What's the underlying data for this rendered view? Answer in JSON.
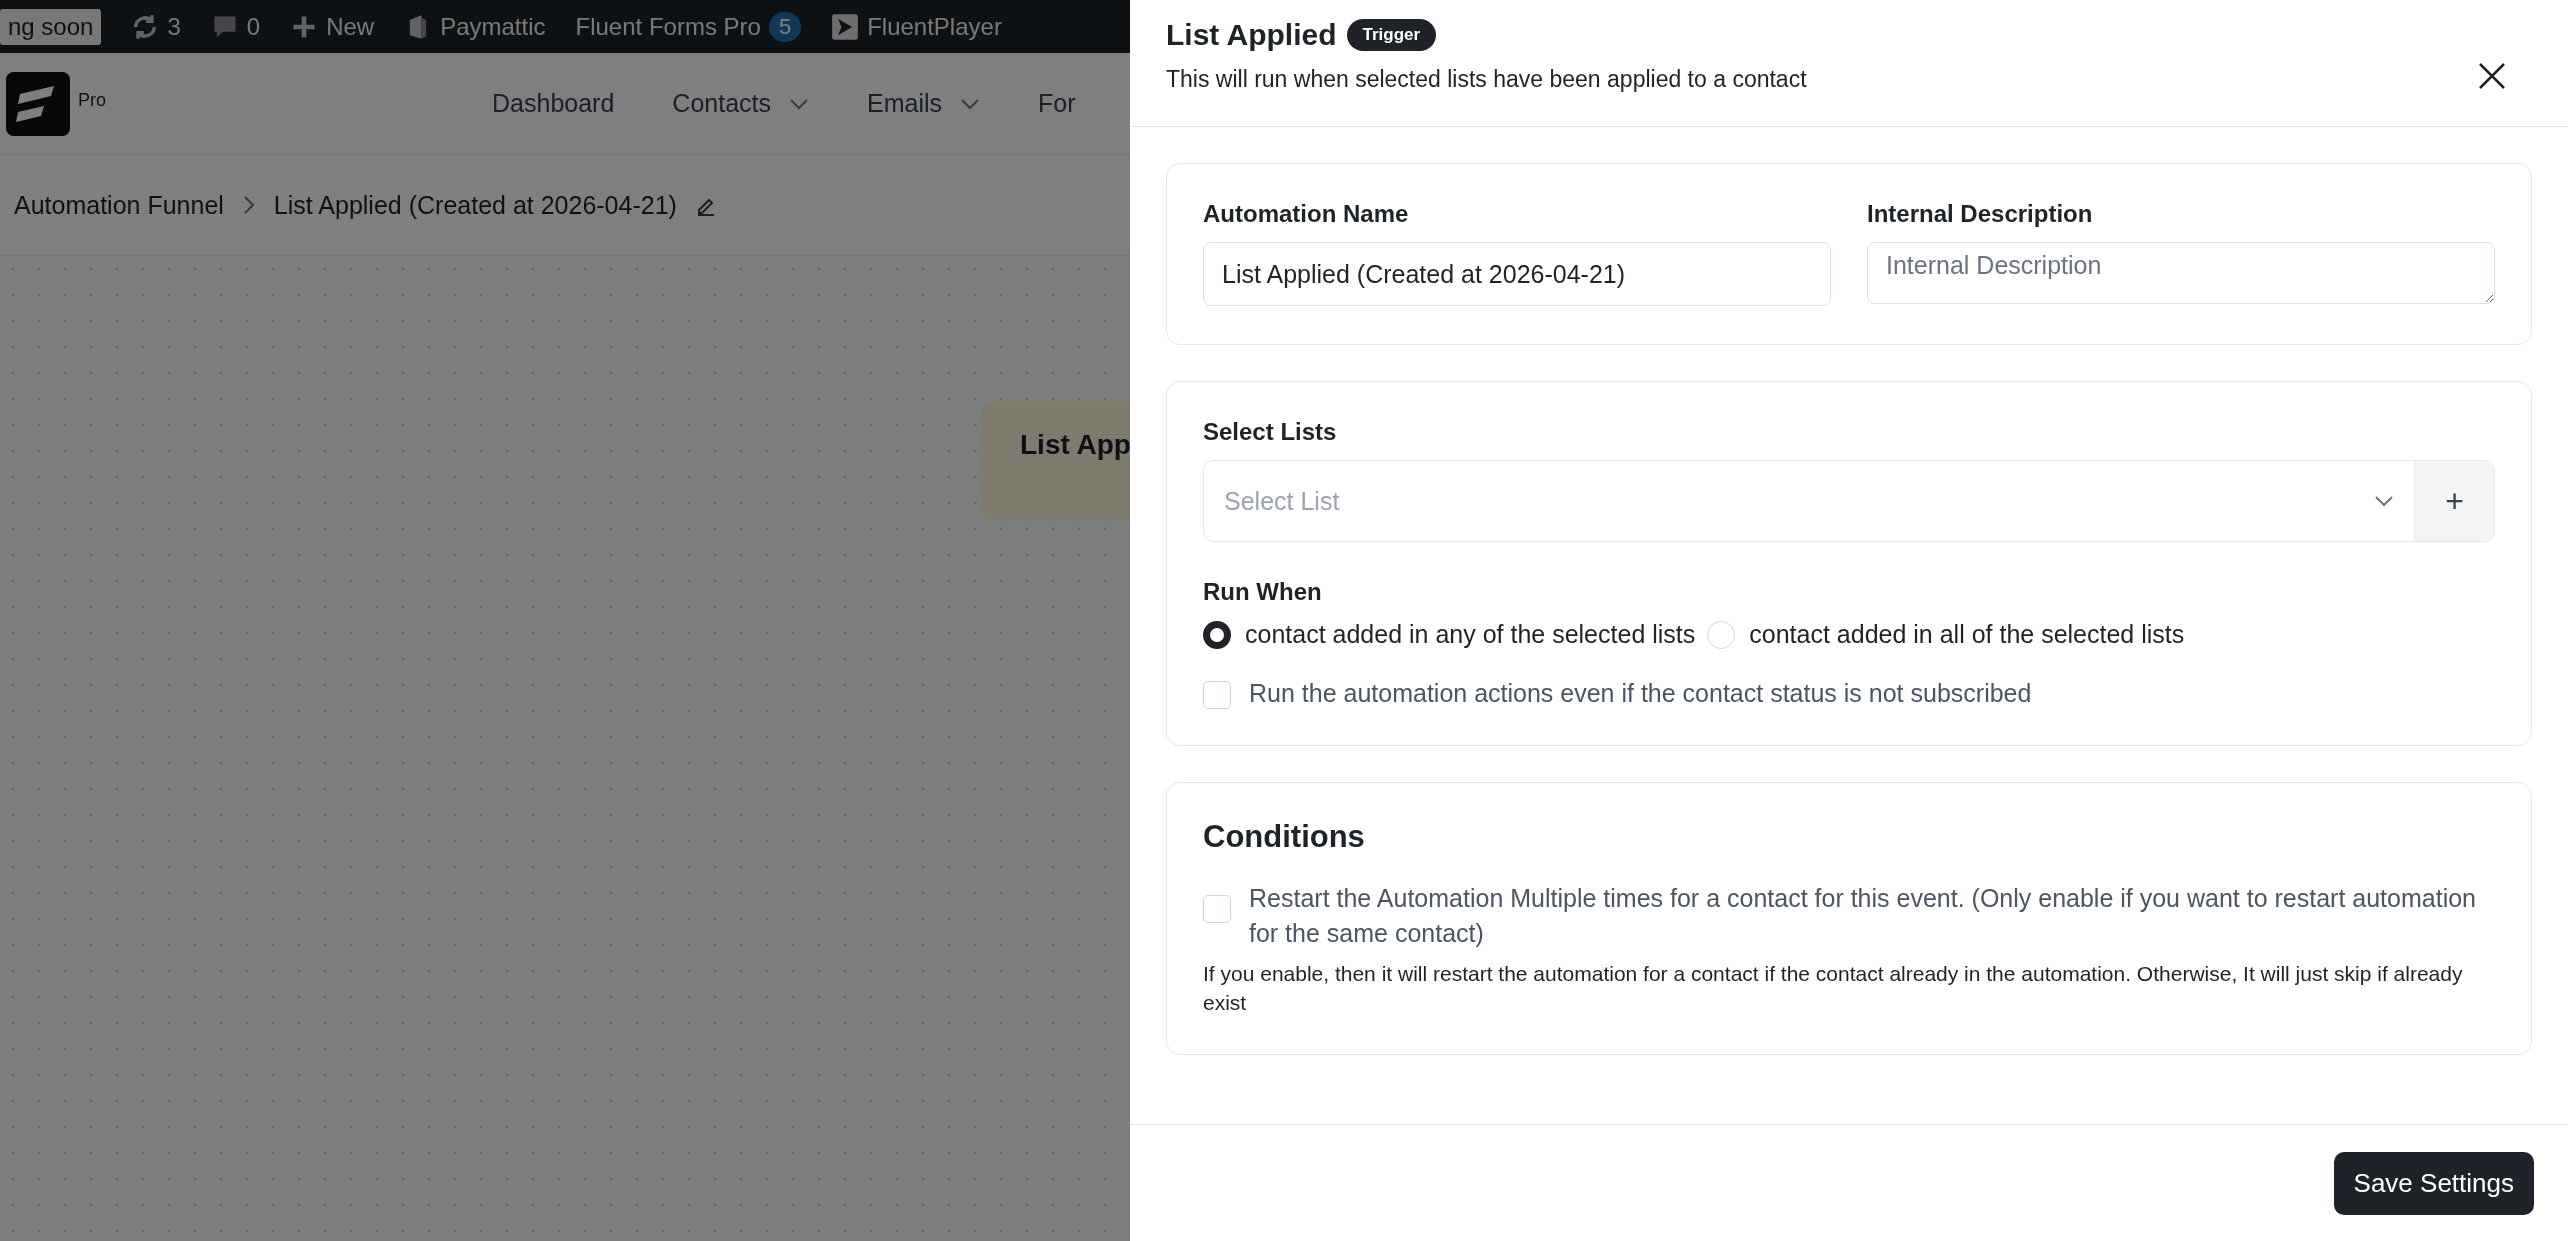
{
  "admin_bar": {
    "items": [
      {
        "kind": "badge",
        "label": "ng soon"
      },
      {
        "kind": "updates",
        "label": "3"
      },
      {
        "kind": "comments",
        "label": "0"
      },
      {
        "kind": "new",
        "label": "New"
      },
      {
        "kind": "paymattic",
        "label": "Paymattic"
      },
      {
        "kind": "plain",
        "label": "Fluent Forms Pro",
        "count": "5"
      },
      {
        "kind": "player",
        "label": "FluentPlayer"
      }
    ]
  },
  "app_nav": {
    "logo_tag": "Pro",
    "items": [
      {
        "label": "Dashboard",
        "dropdown": false
      },
      {
        "label": "Contacts",
        "dropdown": true
      },
      {
        "label": "Emails",
        "dropdown": true
      },
      {
        "label": "For",
        "dropdown": false
      }
    ]
  },
  "breadcrumb": [
    "Automation Funnel",
    "List Applied (Created at 2026-04-21)"
  ],
  "canvas": {
    "node_title": "List App"
  },
  "drawer": {
    "title": "List Applied",
    "badge": "Trigger",
    "subtitle": "This will run when selected lists have been applied to a contact",
    "name_label": "Automation Name",
    "name_value": "List Applied (Created at 2026-04-21)",
    "description_label": "Internal Description",
    "description_placeholder": "Internal Description",
    "lists_label": "Select Lists",
    "lists_placeholder": "Select List",
    "add_button": "+",
    "run_when_label": "Run When",
    "run_when_options": [
      {
        "label": "contact added in any of the selected lists",
        "selected": true
      },
      {
        "label": "contact added in all of the selected lists",
        "selected": false
      }
    ],
    "run_unsubscribed": {
      "label": "Run the automation actions even if the contact status is not subscribed",
      "checked": false
    },
    "conditions_title": "Conditions",
    "restart": {
      "label": "Restart the Automation Multiple times for a contact for this event. (Only enable if you want to restart automation for the same contact)",
      "checked": false
    },
    "restart_help": "If you enable, then it will restart the automation for a contact if the contact already in the automation. Otherwise, It will just skip if already exist",
    "save_button": "Save Settings"
  }
}
